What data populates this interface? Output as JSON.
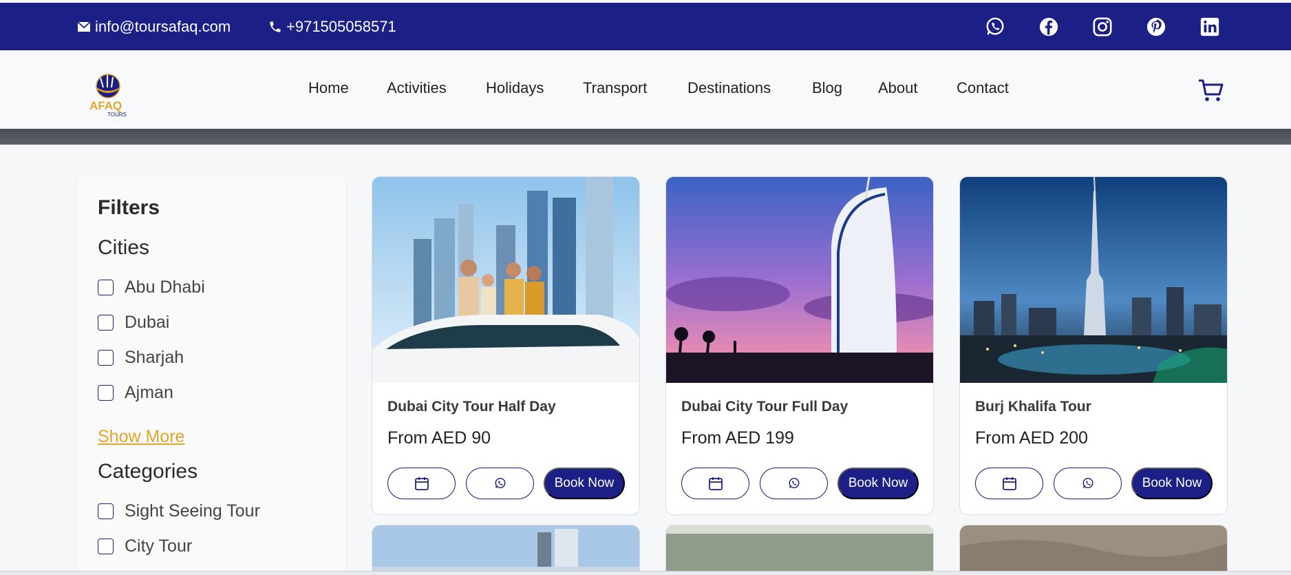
{
  "topbar": {
    "email": "info@toursafaq.com",
    "phone": "+971505058571",
    "social": [
      "whatsapp-icon",
      "facebook-icon",
      "instagram-icon",
      "pinterest-icon",
      "linkedin-icon"
    ]
  },
  "nav": {
    "logo_text": "AFAQ",
    "logo_sub": "TOURS",
    "items": [
      "Home",
      "Activities",
      "Holidays",
      "Transport",
      "Destinations",
      "Blog",
      "About",
      "Contact"
    ],
    "cart_icon": "cart-icon"
  },
  "filters": {
    "title": "Filters",
    "cities_heading": "Cities",
    "cities": [
      "Abu Dhabi",
      "Dubai",
      "Sharjah",
      "Ajman"
    ],
    "show_more": "Show More",
    "categories_heading": "Categories",
    "categories": [
      "Sight Seeing Tour",
      "City Tour"
    ]
  },
  "cards": [
    {
      "title": "Dubai City Tour Half Day",
      "price": "From AED 90",
      "book": "Book Now"
    },
    {
      "title": "Dubai City Tour Full Day",
      "price": "From AED 199",
      "book": "Book Now"
    },
    {
      "title": "Burj Khalifa Tour",
      "price": "From AED 200",
      "book": "Book Now"
    }
  ],
  "colors": {
    "brand": "#1b1f86",
    "accent": "#e2a52a",
    "background": "#f6f7f9"
  }
}
